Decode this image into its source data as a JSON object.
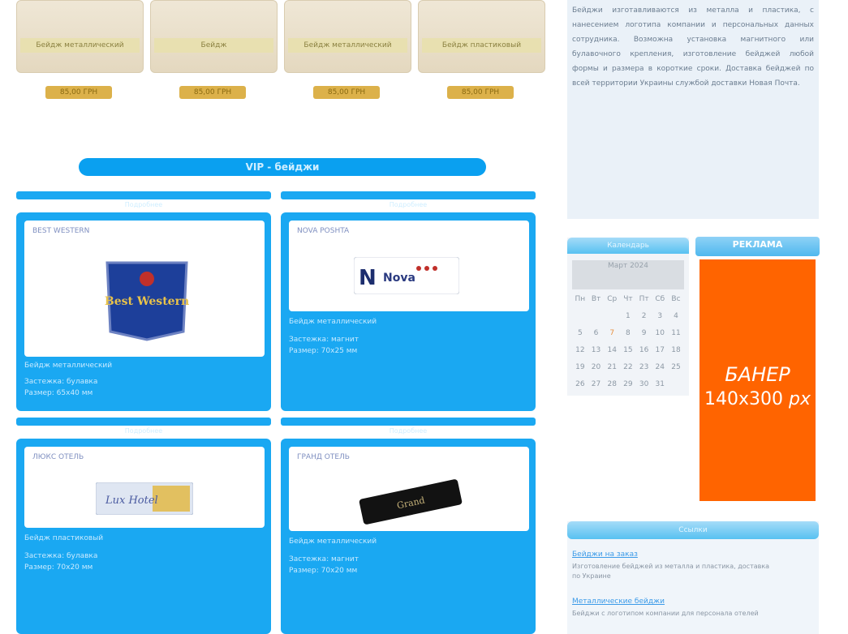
{
  "products": [
    {
      "name": "Бейдж металлический",
      "price": "85,00 ГРН"
    },
    {
      "name": "Бейдж",
      "price": "85,00 ГРН"
    },
    {
      "name": "Бейдж металлический",
      "price": "85,00 ГРН"
    },
    {
      "name": "Бейдж пластиковый",
      "price": "85,00 ГРН"
    }
  ],
  "vip": {
    "title": "VIP - бейджи",
    "strip_labels": [
      "Подробнее",
      "Подробнее",
      "Подробнее",
      "Подробнее"
    ],
    "cards": [
      {
        "name": "BEST WESTERN",
        "logo_text": "Best Western",
        "lines": [
          "Бейдж металлический",
          "Застежка: булавка",
          "Размер: 65х40 мм"
        ]
      },
      {
        "name": "NOVA POSHTA",
        "logo_text": "Nova",
        "lines": [
          "Бейдж металлический",
          "Застежка: магнит",
          "Размер: 70х25 мм"
        ]
      },
      {
        "name": "ЛЮКС ОТЕЛЬ",
        "logo_text": "Lux Hotel",
        "lines": [
          "Бейдж пластиковый",
          "Застежка: булавка",
          "Размер: 70х20 мм"
        ]
      },
      {
        "name": "ГРАНД ОТЕЛЬ",
        "logo_text": "Grand",
        "lines": [
          "Бейдж металлический",
          "Застежка: магнит",
          "Размер: 70х20 мм"
        ]
      }
    ]
  },
  "sidebar": {
    "text": "Бейджи изготавливаются из металла и пластика, с нанесением логотипа компании и персональных данных сотрудника. Возможна установка магнитного или булавочного крепления, изготовление бейджей любой формы и размера в короткие сроки. Доставка бейджей по всей территории Украины службой доставки Новая Почта."
  },
  "calendar": {
    "title": "Календарь",
    "month": "Март 2024",
    "weekdays": [
      "Пн",
      "Вт",
      "Ср",
      "Чт",
      "Пт",
      "Сб",
      "Вс"
    ],
    "weeks": [
      [
        "",
        "",
        "",
        "1",
        "2",
        "3",
        "4"
      ],
      [
        "5",
        "6",
        "7",
        "8",
        "9",
        "10",
        "11"
      ],
      [
        "12",
        "13",
        "14",
        "15",
        "16",
        "17",
        "18"
      ],
      [
        "19",
        "20",
        "21",
        "22",
        "23",
        "24",
        "25"
      ],
      [
        "26",
        "27",
        "28",
        "29",
        "30",
        "31",
        ""
      ]
    ],
    "today": "7"
  },
  "banner": {
    "header": "РЕКЛАМА",
    "line1": "БАНЕР",
    "line2_num": "140x300",
    "line2_unit": "px",
    "bg_color": "#ff6400"
  },
  "links": {
    "title": "Ссылки",
    "items": [
      {
        "title": "Бейджи на заказ",
        "desc": "Изготовление бейджей из металла и пластика, доставка по Украине"
      },
      {
        "title": "Металлические бейджи",
        "desc": "Бейджи с логотипом компании для персонала отелей"
      }
    ]
  }
}
